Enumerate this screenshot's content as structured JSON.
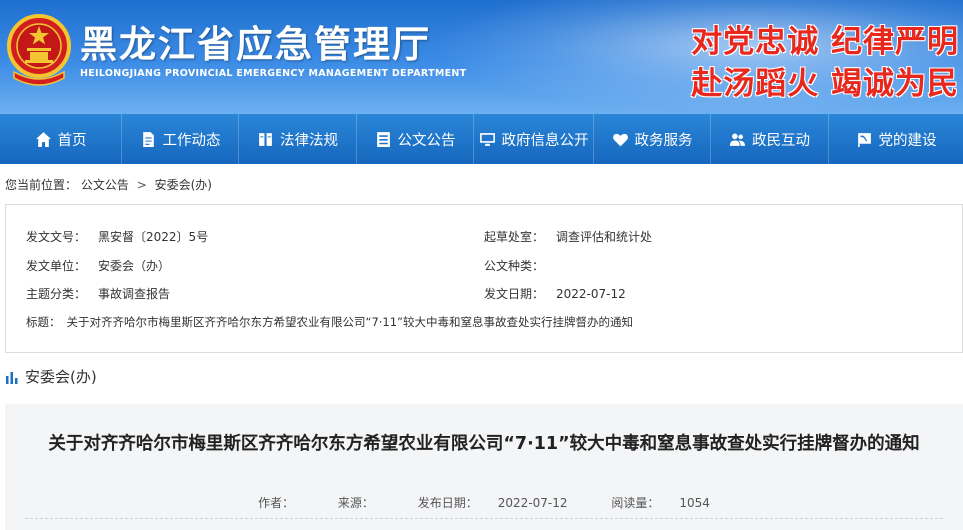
{
  "header": {
    "site_title": "黑龙江省应急管理厅",
    "site_subtitle": "HEILONGJIANG PROVINCIAL EMERGENCY MANAGEMENT DEPARTMENT",
    "slogan_line1": "对党忠诚  纪律严明",
    "slogan_line2": "赴汤蹈火  竭诚为民",
    "emblem_icon": "national-emblem-icon"
  },
  "nav": {
    "items": [
      {
        "label": "首页",
        "icon": "home-icon"
      },
      {
        "label": "工作动态",
        "icon": "document-icon"
      },
      {
        "label": "法律法规",
        "icon": "law-book-icon"
      },
      {
        "label": "公文公告",
        "icon": "announcement-list-icon"
      },
      {
        "label": "政府信息公开",
        "icon": "monitor-icon"
      },
      {
        "label": "政务服务",
        "icon": "heart-icon"
      },
      {
        "label": "政民互动",
        "icon": "people-icon"
      },
      {
        "label": "党的建设",
        "icon": "party-flag-icon"
      }
    ]
  },
  "breadcrumb": {
    "prefix": "您当前位置：",
    "level1": "公文公告",
    "separator": ">",
    "level2": "安委会(办)"
  },
  "info": {
    "doc_no_label": "发文文号：",
    "doc_no": "黑安督〔2022〕5号",
    "drafting_office_label": "起草处室：",
    "drafting_office": "调查评估和统计处",
    "issuer_label": "发文单位：",
    "issuer": "安委会（办）",
    "doc_type_label": "公文种类：",
    "doc_type": "",
    "topic_label": "主题分类：",
    "topic": "事故调查报告",
    "date_label": "发文日期：",
    "date": "2022-07-12",
    "title_label": "标题：",
    "title": "关于对齐齐哈尔市梅里斯区齐齐哈尔东方希望农业有限公司“7·11”较大中毒和窒息事故查处实行挂牌督办的通知"
  },
  "section": {
    "label": "安委会(办)",
    "icon": "bar-chart-icon"
  },
  "article": {
    "title": "关于对齐齐哈尔市梅里斯区齐齐哈尔东方希望农业有限公司“7·11”较大中毒和窒息事故查处实行挂牌督办的通知",
    "author_label": "作者：",
    "source_label": "来源：",
    "publish_date_label": "发布日期：",
    "publish_date": "2022-07-12",
    "views_label": "阅读量：",
    "views": "1054"
  },
  "colors": {
    "nav_bg": "#1a6fc6",
    "slogan_red": "#e8281c",
    "banner_blue": "#2f7fdc"
  }
}
